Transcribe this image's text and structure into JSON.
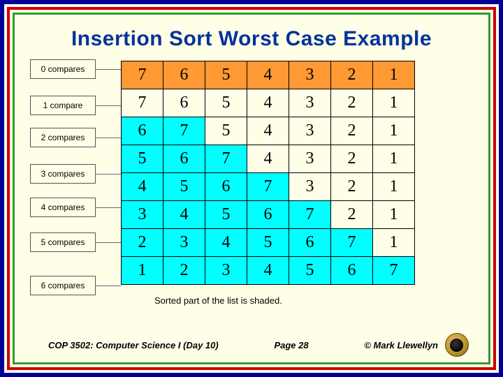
{
  "title": "Insertion Sort Worst Case Example",
  "labels": [
    "0 compares",
    "1 compare",
    "2 compares",
    "3 compares",
    "4 compares",
    "5 compares",
    "6 compares"
  ],
  "caption": "Sorted part of the list is shaded.",
  "footer": {
    "left": "COP 3502: Computer Science I  (Day 10)",
    "mid": "Page 28",
    "right": "© Mark Llewellyn"
  },
  "chart_data": {
    "type": "table",
    "title": "Insertion sort passes on reversed list 7..1 (worst case)",
    "rows": [
      [
        7,
        6,
        5,
        4,
        3,
        2,
        1
      ],
      [
        7,
        6,
        5,
        4,
        3,
        2,
        1
      ],
      [
        6,
        7,
        5,
        4,
        3,
        2,
        1
      ],
      [
        5,
        6,
        7,
        4,
        3,
        2,
        1
      ],
      [
        4,
        5,
        6,
        7,
        3,
        2,
        1
      ],
      [
        3,
        4,
        5,
        6,
        7,
        2,
        1
      ],
      [
        2,
        3,
        4,
        5,
        6,
        7,
        1
      ],
      [
        1,
        2,
        3,
        4,
        5,
        6,
        7
      ]
    ],
    "highlight": {
      "orange_row": 0,
      "cyan_sorted_prefix_len_by_row": [
        0,
        0,
        2,
        3,
        4,
        5,
        6,
        7
      ]
    },
    "compares_per_row": [
      0,
      1,
      2,
      3,
      4,
      5,
      6
    ]
  },
  "cells": {
    "r0c0": "7",
    "r0c1": "6",
    "r0c2": "5",
    "r0c3": "4",
    "r0c4": "3",
    "r0c5": "2",
    "r0c6": "1",
    "r1c0": "7",
    "r1c1": "6",
    "r1c2": "5",
    "r1c3": "4",
    "r1c4": "3",
    "r1c5": "2",
    "r1c6": "1",
    "r2c0": "6",
    "r2c1": "7",
    "r2c2": "5",
    "r2c3": "4",
    "r2c4": "3",
    "r2c5": "2",
    "r2c6": "1",
    "r3c0": "5",
    "r3c1": "6",
    "r3c2": "7",
    "r3c3": "4",
    "r3c4": "3",
    "r3c5": "2",
    "r3c6": "1",
    "r4c0": "4",
    "r4c1": "5",
    "r4c2": "6",
    "r4c3": "7",
    "r4c4": "3",
    "r4c5": "2",
    "r4c6": "1",
    "r5c0": "3",
    "r5c1": "4",
    "r5c2": "5",
    "r5c3": "6",
    "r5c4": "7",
    "r5c5": "2",
    "r5c6": "1",
    "r6c0": "2",
    "r6c1": "3",
    "r6c2": "4",
    "r6c3": "5",
    "r6c4": "6",
    "r6c5": "7",
    "r6c6": "1",
    "r7c0": "1",
    "r7c1": "2",
    "r7c2": "3",
    "r7c3": "4",
    "r7c4": "5",
    "r7c5": "6",
    "r7c6": "7"
  }
}
